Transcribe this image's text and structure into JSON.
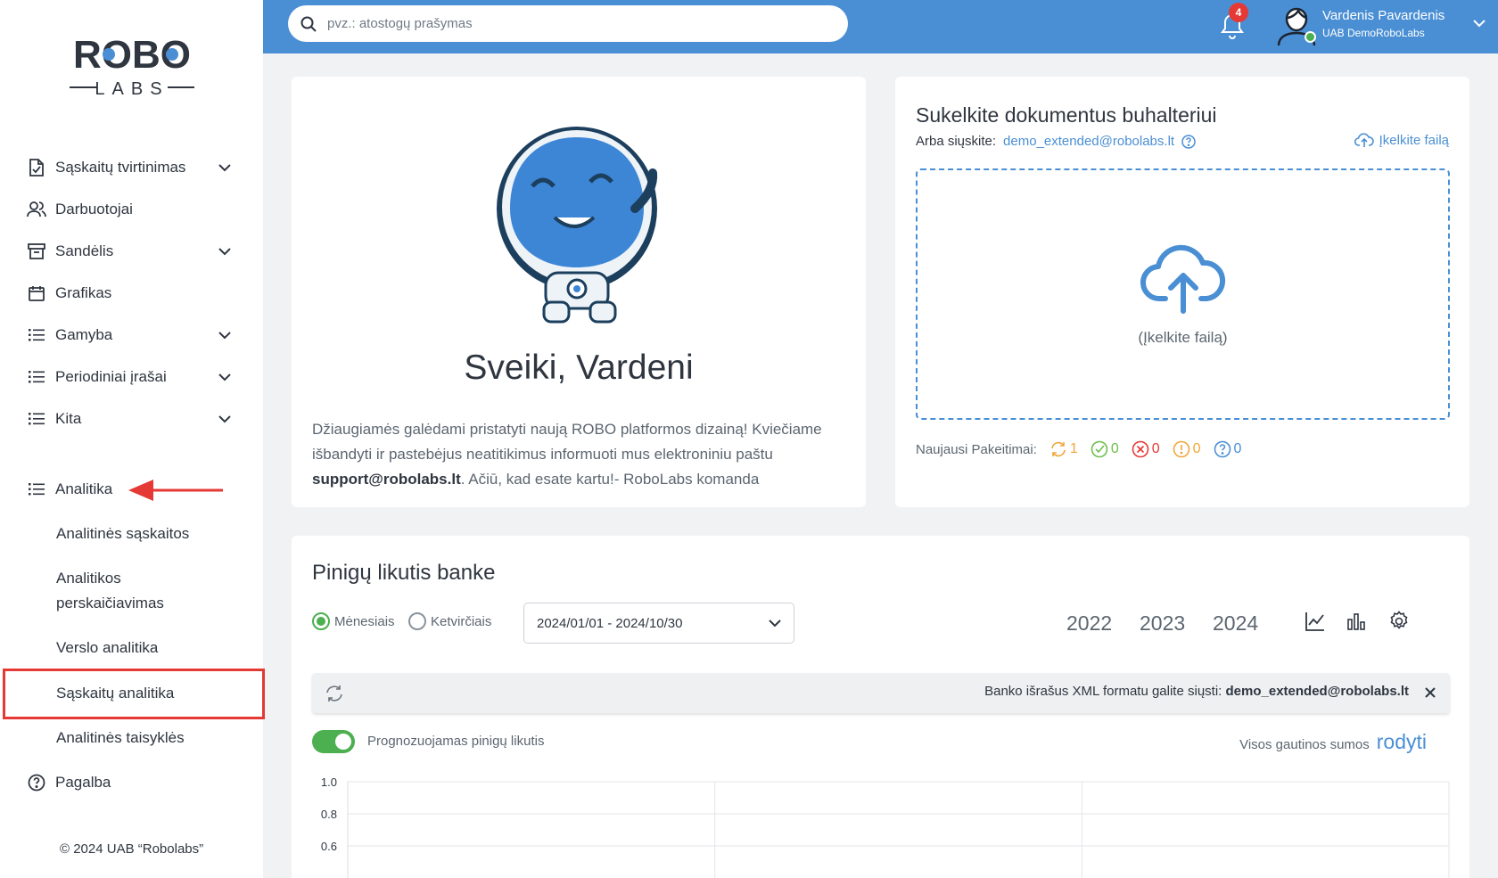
{
  "logo": {
    "top": "ROBO",
    "bottom": "LABS"
  },
  "sidebar": {
    "items": [
      {
        "label": "Sąskaitų tvirtinimas",
        "icon": "document-check-icon",
        "has_chevron": true
      },
      {
        "label": "Darbuotojai",
        "icon": "users-icon",
        "has_chevron": false
      },
      {
        "label": "Sandėlis",
        "icon": "archive-box-icon",
        "has_chevron": true
      },
      {
        "label": "Grafikas",
        "icon": "calendar-icon",
        "has_chevron": false
      },
      {
        "label": "Gamyba",
        "icon": "list-icon",
        "has_chevron": true
      },
      {
        "label": "Periodiniai įrašai",
        "icon": "list-icon",
        "has_chevron": true
      },
      {
        "label": "Kita",
        "icon": "list-icon",
        "has_chevron": true
      },
      {
        "label": "Analitika",
        "icon": "list-icon",
        "has_chevron": false
      }
    ],
    "subitems": [
      "Analitinės sąskaitos",
      "Analitikos perskaičiavimas",
      "Verslo analitika",
      "Sąskaitų analitika",
      "Analitinės taisyklės"
    ],
    "help_label": "Pagalba",
    "copyright": "© 2024 UAB “Robolabs”"
  },
  "header": {
    "search_placeholder": "pvz.: atostogų prašymas",
    "notification_count": "4",
    "user_name": "Vardenis Pavardenis",
    "user_company": "UAB DemoRoboLabs"
  },
  "welcome": {
    "title": "Sveiki, Vardeni",
    "text_before": "Džiaugiamės galėdami pristatyti naują ROBO platformos dizainą! Kviečiame išbandyti ir pastebėjus neatitikimus informuoti mus elektroniniu paštu ",
    "email": "support@robolabs.lt",
    "text_after": ". Ačiū, kad esate kartu!- RoboLabs komanda"
  },
  "upload": {
    "title": "Sukelkite dokumentus buhalteriui",
    "send_label": "Arba siųskite:",
    "send_email": "demo_extended@robolabs.lt",
    "upload_link": "Įkelkite failą",
    "drop_label": "(Įkelkite failą)",
    "changes_label": "Naujausi Pakeitimai:",
    "changes": [
      {
        "icon": "refresh-icon",
        "count": "1",
        "color": "#f0a63a"
      },
      {
        "icon": "check-circle-icon",
        "count": "0",
        "color": "#6cbf4b"
      },
      {
        "icon": "x-circle-icon",
        "count": "0",
        "color": "#e53935"
      },
      {
        "icon": "warning-circle-icon",
        "count": "0",
        "color": "#f0a63a"
      },
      {
        "icon": "question-circle-icon",
        "count": "0",
        "color": "#4a8fd4"
      }
    ]
  },
  "bank": {
    "title": "Pinigų likutis banke",
    "radio_monthly": "Mėnesiais",
    "radio_quarterly": "Ketvirčiais",
    "date_range": "2024/01/01 - 2024/10/30",
    "years": [
      "2022",
      "2023",
      "2024"
    ],
    "info_text": "Banko išrašus XML formatu galite siųsti: ",
    "info_email": "demo_extended@robolabs.lt",
    "toggle_label": "Prognozuojamas pinigų likutis",
    "all_sums_label": "Visos gautinos sumos",
    "all_sums_link": "rodyti"
  },
  "chart_data": {
    "type": "line",
    "y_ticks": [
      "1.0",
      "0.8",
      "0.6"
    ],
    "series": []
  },
  "colors": {
    "accent": "#4a8fd4",
    "success": "#4caf50",
    "annotation": "#e53935"
  }
}
